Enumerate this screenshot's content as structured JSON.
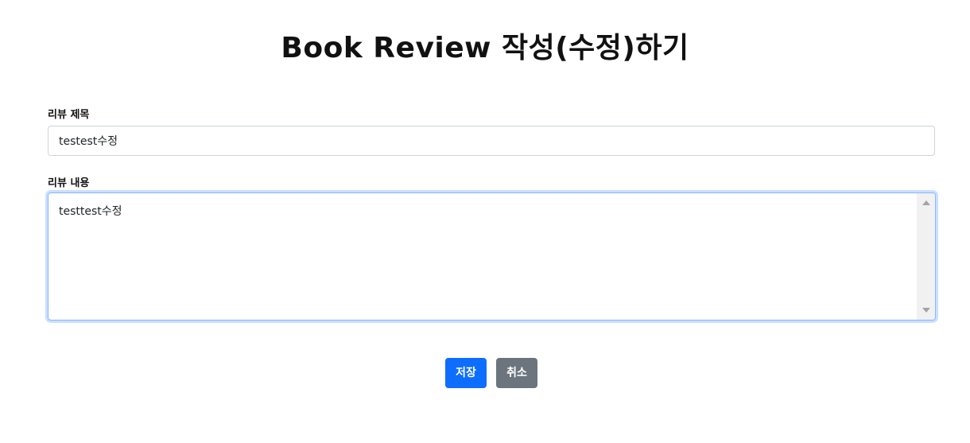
{
  "page": {
    "title": "Book Review 작성(수정)하기"
  },
  "form": {
    "title_label": "리뷰 제목",
    "title_value": "testest수정",
    "content_label": "리뷰 내용",
    "content_value": "testtest수정"
  },
  "actions": {
    "save_label": "저장",
    "cancel_label": "취소"
  },
  "colors": {
    "primary": "#0d6efd",
    "secondary": "#6c757d",
    "focus_border": "#86b7fe",
    "input_border": "#ced4da"
  }
}
